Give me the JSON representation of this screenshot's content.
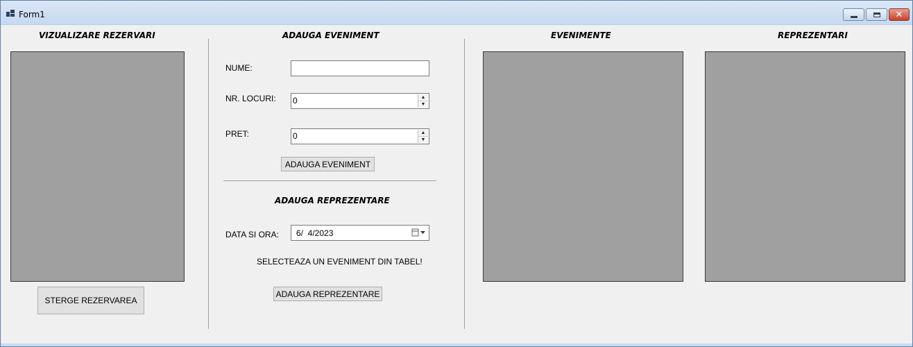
{
  "window": {
    "title": "Form1"
  },
  "headers": {
    "view_reservations": "VIZUALIZARE REZERVARI",
    "add_event": "ADAUGA EVENIMENT",
    "events": "EVENIMENTE",
    "representations": "REPREZENTARI",
    "add_representation": "ADAUGA REPREZENTARE"
  },
  "event_form": {
    "name_label": "NUME:",
    "name_value": "",
    "seats_label": "NR. LOCURI:",
    "seats_value": "0",
    "price_label": "PRET:",
    "price_value": "0",
    "add_button": "ADAUGA EVENIMENT"
  },
  "representation_form": {
    "date_label": "DATA SI ORA:",
    "date_value": "6/  4/2023",
    "hint": "SELECTEAZA UN EVENIMENT DIN TABEL!",
    "add_button": "ADAUGA REPREZENTARE"
  },
  "reservations": {
    "delete_button": "STERGE REZERVAREA"
  },
  "icons": {
    "app": "window-app-icon",
    "minimize": "minimize-icon",
    "maximize": "maximize-icon",
    "close": "close-icon",
    "spin_up": "spin-up-icon",
    "spin_down": "spin-down-icon",
    "calendar": "calendar-dropdown-icon"
  }
}
